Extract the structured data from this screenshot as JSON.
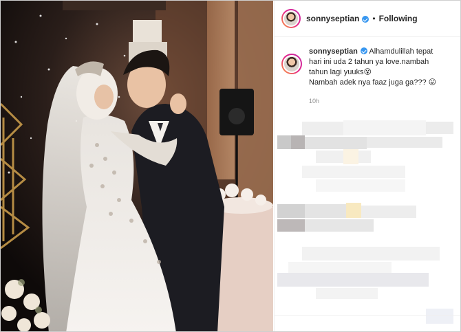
{
  "post": {
    "username": "sonnyseptian",
    "follow_status": "Following",
    "separator": "•",
    "caption": {
      "line1": "Alhamdulillah tepat",
      "line2": "hari ini uda 2 tahun ya love.nambah",
      "line3": "tahun lagi yuuks😵",
      "line4": "Nambah adek nya faaz juga ga??? 😛"
    },
    "time_ago": "10h"
  },
  "icons": {
    "verified": "verified-badge-icon",
    "avatar": "profile-avatar"
  },
  "colors": {
    "verified_blue": "#3897f0",
    "username_text": "#262626",
    "timestamp_gray": "#8e8e8e"
  }
}
